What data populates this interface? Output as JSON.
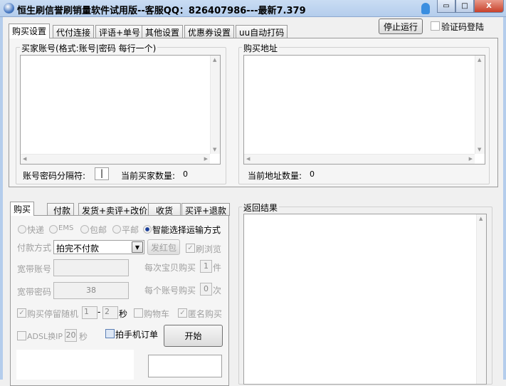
{
  "window": {
    "title": "恒生刷信誉刷销量软件试用版--客服QQ：826407986---最新7.379",
    "min": "▭",
    "max": "□",
    "close": "X"
  },
  "top_tabs": [
    "购买设置",
    "代付连接",
    "评语+单号",
    "其他设置",
    "优惠券设置",
    "uu自动打码"
  ],
  "stop_button": "停止运行",
  "captcha_login": "验证码登陆",
  "buyer_group": {
    "label": "买家账号(格式:账号|密码 每行一个)",
    "separator_label": "账号密码分隔符:",
    "separator_value": "|",
    "count_label": "当前买家数量:",
    "count": "0"
  },
  "address_group": {
    "label": "购买地址",
    "count_label": "当前地址数量:",
    "count": "0"
  },
  "bottom_tabs": [
    "购买",
    "付款",
    "发货+卖评+改价",
    "收货",
    "买评+退款"
  ],
  "shipping": {
    "options": [
      "快递",
      "EMS",
      "包邮",
      "平邮",
      "智能选择运输方式"
    ],
    "selected": "智能选择运输方式"
  },
  "payment": {
    "label": "付款方式",
    "value": "拍完不付款",
    "red_packet": "发红包",
    "brush_views": "刷浏览"
  },
  "broadband_account": {
    "label": "宽带账号",
    "value": ""
  },
  "broadband_password": {
    "label": "宽带密码",
    "value": "38"
  },
  "per_item": {
    "label": "每次宝贝购买",
    "value": "1",
    "unit": "件"
  },
  "per_account": {
    "label": "每个账号购买",
    "value": "0",
    "unit": "次"
  },
  "stay": {
    "label": "购买停留随机",
    "min": "1",
    "dash": "-",
    "max": "2",
    "unit": "秒"
  },
  "cart": "购物车",
  "anonymous": "匿名购买",
  "adsl": {
    "label": "ADSL换IP",
    "value": "20",
    "unit": "秒"
  },
  "mobile_order": "拍手机订单",
  "start_button": "开始",
  "result_group": {
    "label": "返回结果"
  }
}
